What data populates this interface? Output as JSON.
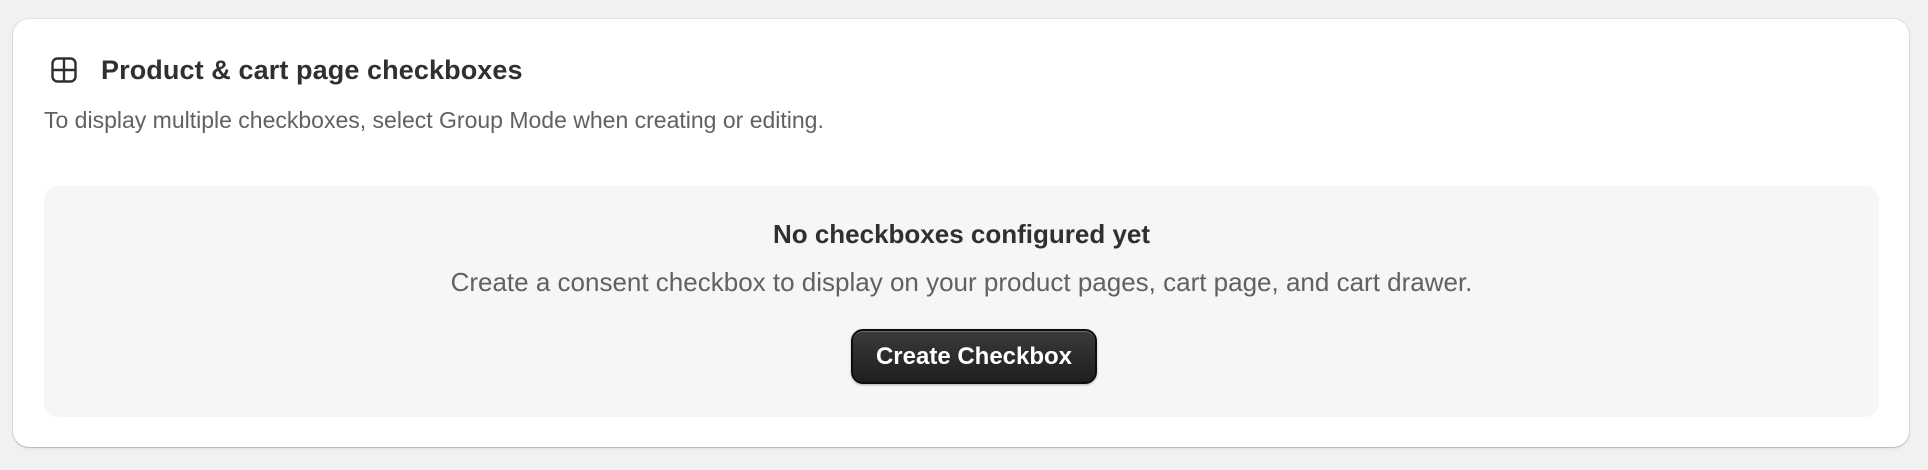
{
  "card": {
    "icon": "layout-blocks-icon",
    "title": "Product & cart page checkboxes",
    "subtitle": "To display multiple checkboxes, select Group Mode when creating or editing."
  },
  "empty_state": {
    "title": "No checkboxes configured yet",
    "text": "Create a consent checkbox to display on your product pages, cart page, and cart drawer.",
    "button_label": "Create Checkbox"
  },
  "colors": {
    "page_background": "#f1f1f1",
    "card_background": "#ffffff",
    "empty_background": "#f6f6f6",
    "button_background": "#2b2b2b",
    "text_primary": "#303030",
    "text_secondary": "#616161"
  }
}
